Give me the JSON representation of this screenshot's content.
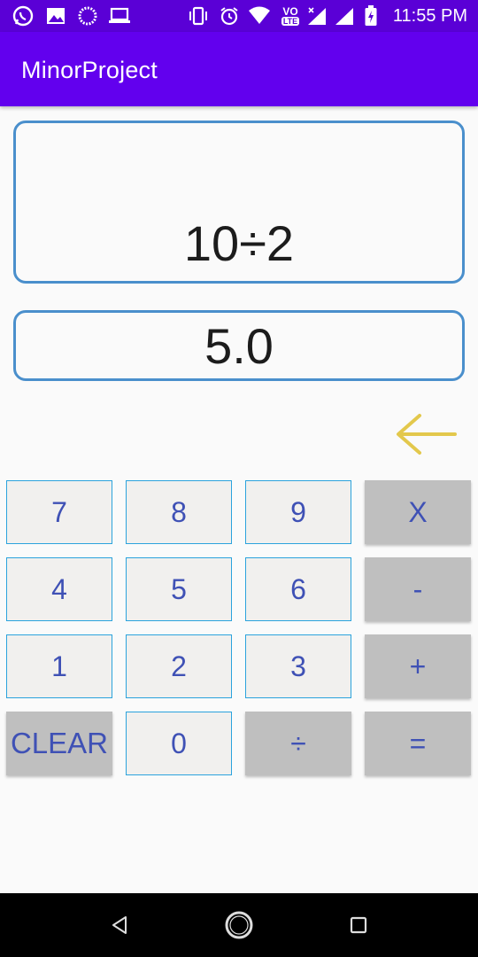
{
  "status_bar": {
    "time": "11:55 PM",
    "icons": [
      "whatsapp-icon",
      "image-icon",
      "sync-icon",
      "laptop-icon",
      "vibrate-icon",
      "alarm-icon",
      "wifi-icon",
      "volte-lte-icon",
      "signal-icon",
      "signal-icon",
      "battery-charging-icon"
    ],
    "volte_label": "VO",
    "lte_label": "LTE"
  },
  "app_bar": {
    "title": "MinorProject"
  },
  "display": {
    "expression": "10÷2",
    "result": "5.0"
  },
  "keypad": {
    "rows": [
      [
        "7",
        "8",
        "9",
        "X"
      ],
      [
        "4",
        "5",
        "6",
        "-"
      ],
      [
        "1",
        "2",
        "3",
        "+"
      ],
      [
        "CLEAR",
        "0",
        "÷",
        "="
      ]
    ]
  },
  "colors": {
    "primary": "#6200ee",
    "status_bar": "#5a00d6",
    "display_border": "#4a8fcc",
    "key_text": "#3f51b5",
    "key_border": "#2ba3dd",
    "operator_key_bg": "#bfbfbf",
    "backspace_arrow": "#e3c84c"
  },
  "nav_bar": {
    "buttons": [
      "back-icon",
      "home-icon",
      "recents-icon"
    ]
  }
}
